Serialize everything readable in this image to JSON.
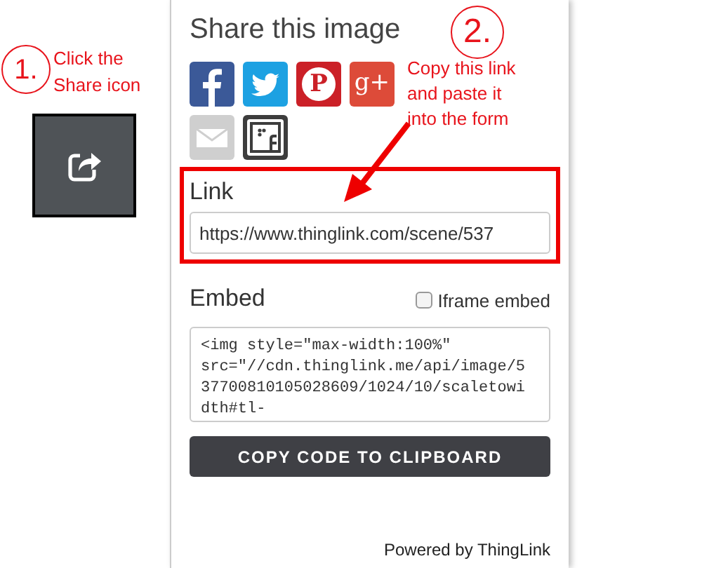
{
  "annotations": [
    {
      "number": "1.",
      "text": [
        "Click the",
        "Share icon"
      ]
    },
    {
      "number": "2.",
      "text": [
        "Copy this link",
        "and paste it",
        "into the form"
      ]
    }
  ],
  "panel": {
    "title": "Share this image",
    "share_buttons": [
      {
        "kind": "facebook"
      },
      {
        "kind": "twitter"
      },
      {
        "kind": "pinterest",
        "label": "P"
      },
      {
        "kind": "googleplus",
        "label": "g+"
      },
      {
        "kind": "email"
      },
      {
        "kind": "thinglink"
      }
    ],
    "link": {
      "label": "Link",
      "value": "https://www.thinglink.com/scene/537"
    },
    "embed": {
      "label": "Embed",
      "iframe_checkbox": {
        "label": "Iframe embed",
        "checked": false
      },
      "code": "<img style=\"max-width:100%\" src=\"//cdn.thinglink.me/api/image/537700810105028609/1024/10/scaletowidth#tl-"
    },
    "copy_button": "COPY CODE TO CLIPBOARD",
    "footer": "Powered by ThingLink"
  }
}
